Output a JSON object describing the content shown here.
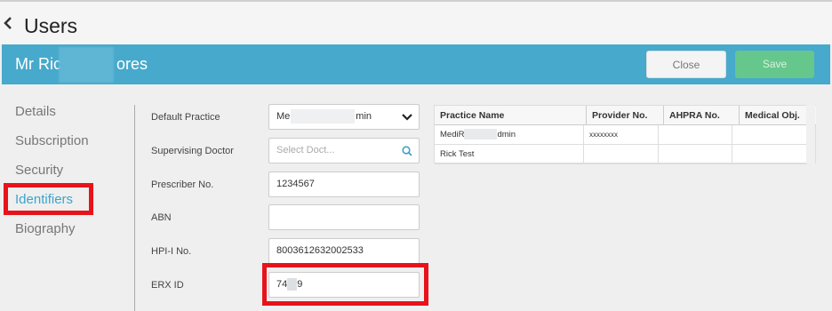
{
  "page": {
    "title": "Users"
  },
  "header": {
    "name": "Mr Ric",
    "name_end": "ores"
  },
  "actions": {
    "close_label": "Close",
    "save_label": "Save"
  },
  "sidebar": {
    "items": [
      {
        "label": "Details"
      },
      {
        "label": "Subscription"
      },
      {
        "label": "Security"
      },
      {
        "label": "Identifiers"
      },
      {
        "label": "Biography"
      }
    ]
  },
  "form": {
    "default_practice": {
      "label": "Default Practice",
      "value_start": "Me",
      "value_end": "min"
    },
    "supervising_doctor": {
      "label": "Supervising Doctor",
      "placeholder": "Select Doct..."
    },
    "prescriber_no": {
      "label": "Prescriber No.",
      "value": "1234567"
    },
    "abn": {
      "label": "ABN",
      "value": ""
    },
    "hpi_i_no": {
      "label": "HPI-I No.",
      "value": "8003612632002533"
    },
    "erx_id": {
      "label": "ERX ID",
      "value_start": "74",
      "value_end": "9"
    }
  },
  "practices_table": {
    "columns": [
      "Practice Name",
      "Provider No.",
      "AHPRA No.",
      "Medical Obj."
    ],
    "rows": [
      {
        "practice_start": "MediR",
        "practice_end": "dmin",
        "provider": "xxxxxxxx",
        "ahpra": "",
        "medical_obj": ""
      },
      {
        "practice": "Rick Test",
        "provider": "",
        "ahpra": "",
        "medical_obj": ""
      }
    ]
  },
  "colors": {
    "header_bg": "#47a9cb",
    "active": "#3da3c9",
    "highlight": "#e8131a",
    "save": "#66c78c"
  }
}
